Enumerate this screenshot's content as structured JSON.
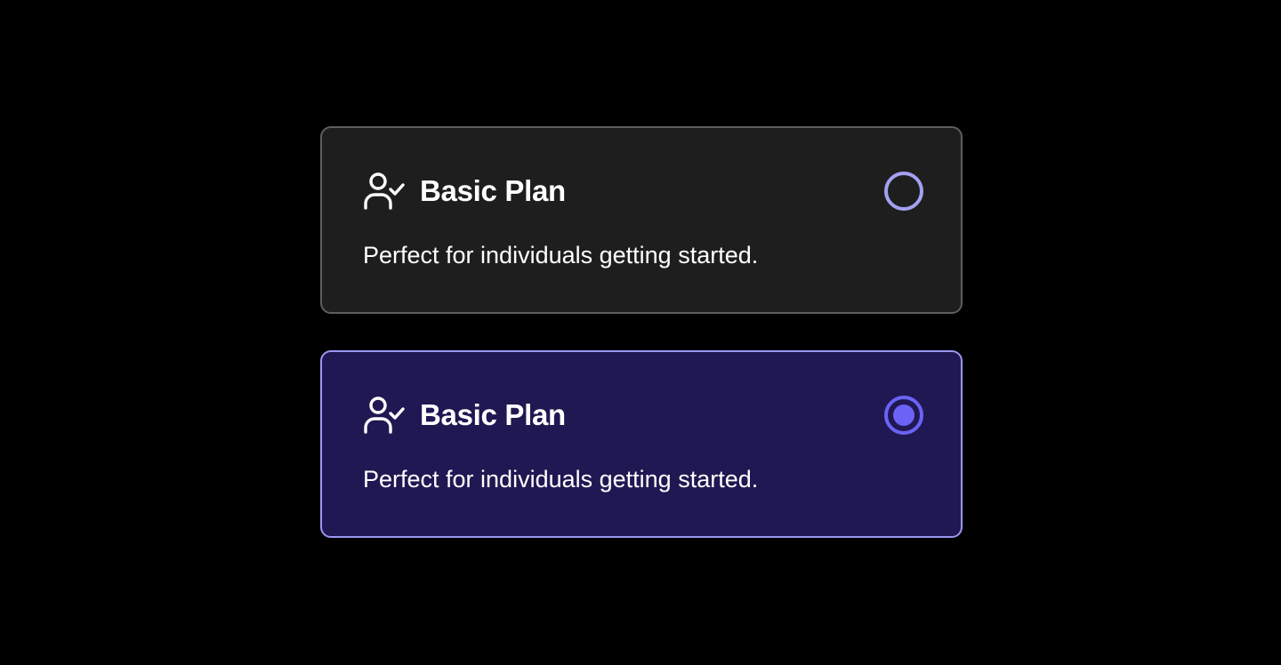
{
  "colors": {
    "background": "#000000",
    "card_default_bg": "#1e1e1e",
    "card_default_border": "#5e5e5e",
    "card_selected_bg": "#201852",
    "card_selected_border": "#9b97f0",
    "radio_unchecked": "#a4a0f2",
    "radio_checked": "#6b63f6",
    "text": "#ffffff"
  },
  "plans": [
    {
      "icon": "user-check-icon",
      "title": "Basic Plan",
      "description": "Perfect for individuals getting started.",
      "selected": false
    },
    {
      "icon": "user-check-icon",
      "title": "Basic Plan",
      "description": "Perfect for individuals getting started.",
      "selected": true
    }
  ]
}
